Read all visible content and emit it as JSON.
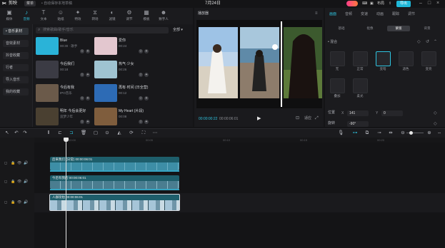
{
  "titlebar": {
    "app_name": "剪映",
    "menu_label": "菜单",
    "draft_info": "• 自动保存本地草稿",
    "project_name": "7月24日",
    "pro_badge": "",
    "layout_label": "布局",
    "export_label": "导出"
  },
  "media_tabs": [
    {
      "label": "媒体",
      "icon": "media-icon"
    },
    {
      "label": "音频",
      "icon": "audio-icon"
    },
    {
      "label": "文本",
      "icon": "text-icon"
    },
    {
      "label": "贴纸",
      "icon": "sticker-icon"
    },
    {
      "label": "特效",
      "icon": "effects-icon"
    },
    {
      "label": "转场",
      "icon": "transition-icon"
    },
    {
      "label": "滤镜",
      "icon": "filter-icon"
    },
    {
      "label": "调节",
      "icon": "adjust-icon"
    },
    {
      "label": "模板",
      "icon": "template-icon"
    },
    {
      "label": "数字人",
      "icon": "avatar-icon"
    }
  ],
  "left_panel": {
    "items": [
      "• 音乐素材",
      "音效素材",
      "抖音收藏",
      "行者",
      "导入音乐",
      "我的收藏"
    ]
  },
  "media_search": {
    "placeholder": "搜索歌曲/歌手/音乐",
    "sort_label": "全部 ▾"
  },
  "media_items": [
    {
      "title": "Blue",
      "sub": "00:30 · 歌手",
      "color": "#2ab3d8"
    },
    {
      "title": "爱你",
      "sub": "00:24",
      "color": "#e3c7cf"
    },
    {
      "title": "今后我们",
      "sub": "00:18",
      "color": "#3b3b44"
    },
    {
      "title": "热气·少女",
      "sub": "00:26",
      "color": "#9fc3d1"
    },
    {
      "title": "今后有我",
      "sub": "IPO音乐",
      "color": "#6b5a4a"
    },
    {
      "title": "再有·时间 (日全营)",
      "sub": "00:12",
      "color": "#2d6bb5"
    },
    {
      "title": "明年 今后会更好",
      "sub": "追梦少年",
      "color": "#4a4031"
    },
    {
      "title": "My Heart (片段)",
      "sub": "00:08",
      "color": "#7f5d3d"
    }
  ],
  "player": {
    "title": "播放器",
    "current_time": "00:00:00:22",
    "total_time": "00:00:06:01",
    "fit_label": "适应"
  },
  "inspector": {
    "tabs": [
      "画面",
      "音频",
      "变速",
      "动画",
      "跟踪",
      "调节"
    ],
    "subtabs": [
      "基础",
      "抠像",
      "蒙版",
      "背景"
    ],
    "section_label": "• 混合",
    "blend_modes": [
      "无",
      "正常",
      "变暗",
      "滤色",
      "变亮",
      "叠加",
      "柔光"
    ],
    "position_label": "位置",
    "x_value": "141",
    "y_value": "0",
    "rotate_label": "旋转",
    "rotate_value": "-90°"
  },
  "tracks": {
    "clip1_title": "后来我们 (日常)  00:00:06:01",
    "clip2_title": "今后有我的    00:00:06:01",
    "clip3_title": "人群街拍  00:00:06:01",
    "cover_label": "封面",
    "ticks": [
      "00:00",
      "00:05",
      "00:10",
      "00:15",
      "00:20"
    ]
  }
}
